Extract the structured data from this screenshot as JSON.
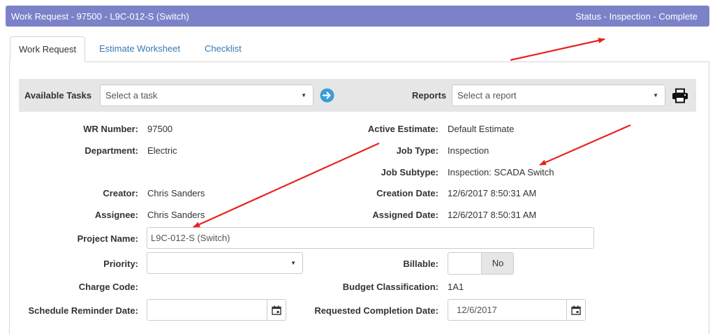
{
  "window": {
    "title": "Work Request - 97500 - L9C-012-S (Switch)",
    "status": "Status - Inspection - Complete",
    "header_color": "#7b82c8"
  },
  "tabs": [
    {
      "label": "Work Request",
      "active": true
    },
    {
      "label": "Estimate Worksheet",
      "active": false
    },
    {
      "label": "Checklist",
      "active": false
    }
  ],
  "toolbar": {
    "tasks_label": "Available Tasks",
    "tasks_placeholder": "Select a task",
    "go_icon": "circle-arrow-right-icon",
    "reports_label": "Reports",
    "reports_placeholder": "Select a report",
    "print_icon": "printer-icon"
  },
  "fields": {
    "wr_number": {
      "label": "WR Number:",
      "value": "97500"
    },
    "department": {
      "label": "Department:",
      "value": "Electric"
    },
    "creator": {
      "label": "Creator:",
      "value": "Chris Sanders"
    },
    "assignee": {
      "label": "Assignee:",
      "value": "Chris Sanders"
    },
    "active_estimate": {
      "label": "Active Estimate:",
      "value": "Default Estimate"
    },
    "job_type": {
      "label": "Job Type:",
      "value": "Inspection"
    },
    "job_subtype": {
      "label": "Job Subtype:",
      "value": "Inspection: SCADA Switch"
    },
    "creation_date": {
      "label": "Creation Date:",
      "value": "12/6/2017 8:50:31 AM"
    },
    "assigned_date": {
      "label": "Assigned Date:",
      "value": "12/6/2017 8:50:31 AM"
    },
    "project_name": {
      "label": "Project Name:",
      "value": "L9C-012-S (Switch)"
    },
    "priority": {
      "label": "Priority:",
      "value": ""
    },
    "billable": {
      "label": "Billable:",
      "value": "No"
    },
    "charge_code": {
      "label": "Charge Code:",
      "value": ""
    },
    "budget_classification": {
      "label": "Budget Classification:",
      "value": "1A1"
    },
    "schedule_reminder_date": {
      "label": "Schedule Reminder Date:",
      "value": ""
    },
    "requested_completion_date": {
      "label": "Requested Completion Date:",
      "value": "12/6/2017"
    }
  },
  "annotation_color": "#e8231f"
}
